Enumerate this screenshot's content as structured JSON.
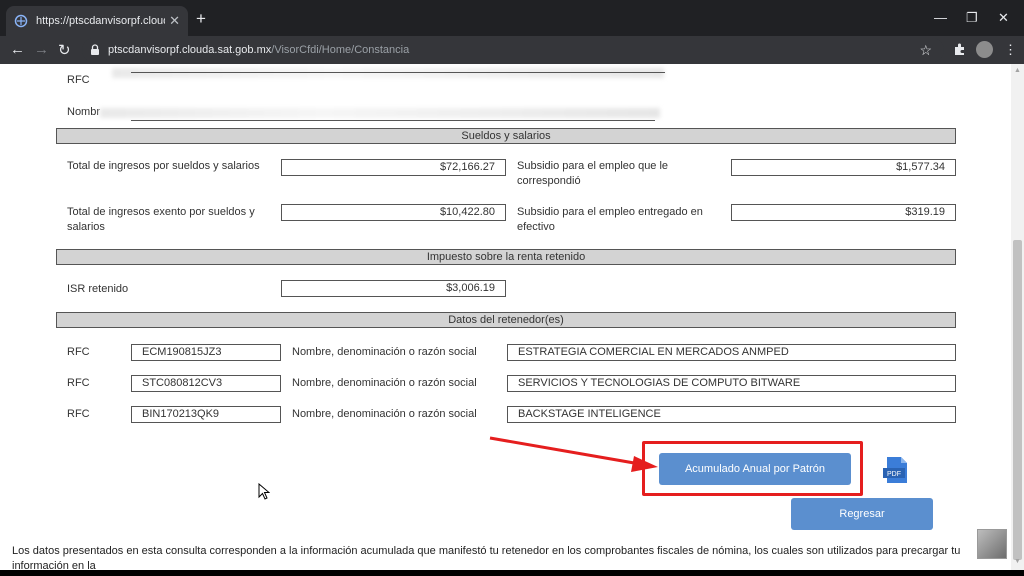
{
  "browser": {
    "tab_title": "https://ptscdanvisorpf.clouda.sat",
    "tab_close": "✕",
    "new_tab": "+",
    "url_host": "ptscdanvisorpf.clouda.sat.gob.mx",
    "url_path": "/VisorCfdi/Home/Constancia",
    "icons": [
      "favicon",
      "lock-icon",
      "star-icon",
      "extensions-icon",
      "profile-icon",
      "menu-icon"
    ]
  },
  "contribuyente": {
    "rfc_label": "RFC",
    "nombre_label": "Nombr"
  },
  "sueldos": {
    "title": "Sueldos y salarios",
    "total_ingresos_label": "Total de ingresos por sueldos y salarios",
    "total_ingresos_value": "$72,166.27",
    "subsidio_correspondio_label_1": "Subsidio para el empleo que le",
    "subsidio_correspondio_label_2": "correspondió",
    "subsidio_correspondio_value": "$1,577.34",
    "exento_label_1": "Total de ingresos exento por sueldos y",
    "exento_label_2": "salarios",
    "exento_value": "$10,422.80",
    "subsidio_entregado_label_1": "Subsidio para el empleo entregado en",
    "subsidio_entregado_label_2": "efectivo",
    "subsidio_entregado_value": "$319.19"
  },
  "isr": {
    "title": "Impuesto sobre la renta retenido",
    "label": "ISR retenido",
    "value": "$3,006.19"
  },
  "retenedores": {
    "title": "Datos del retenedor(es)",
    "rfc_label": "RFC",
    "nombre_label": "Nombre, denominación o razón social",
    "rows": [
      {
        "rfc": "ECM190815JZ3",
        "nombre": "ESTRATEGIA COMERCIAL EN MERCADOS ANMPED"
      },
      {
        "rfc": "STC080812CV3",
        "nombre": "SERVICIOS Y TECNOLOGIAS DE COMPUTO BITWARE"
      },
      {
        "rfc": "BIN170213QK9",
        "nombre": "BACKSTAGE INTELIGENCE"
      }
    ]
  },
  "actions": {
    "acumulado_label": "Acumulado Anual por Patrón",
    "regresar_label": "Regresar",
    "pdf_label": "PDF"
  },
  "footer": {
    "text": "Los datos presentados en esta consulta corresponden a la información acumulada que manifestó tu retenedor en los comprobantes fiscales de nómina, los cuales son utilizados para precargar tu información en la"
  },
  "colors": {
    "button_blue": "#5b8fcf",
    "highlight_red": "#e51e1e",
    "section_gray": "#d3d3d3"
  }
}
